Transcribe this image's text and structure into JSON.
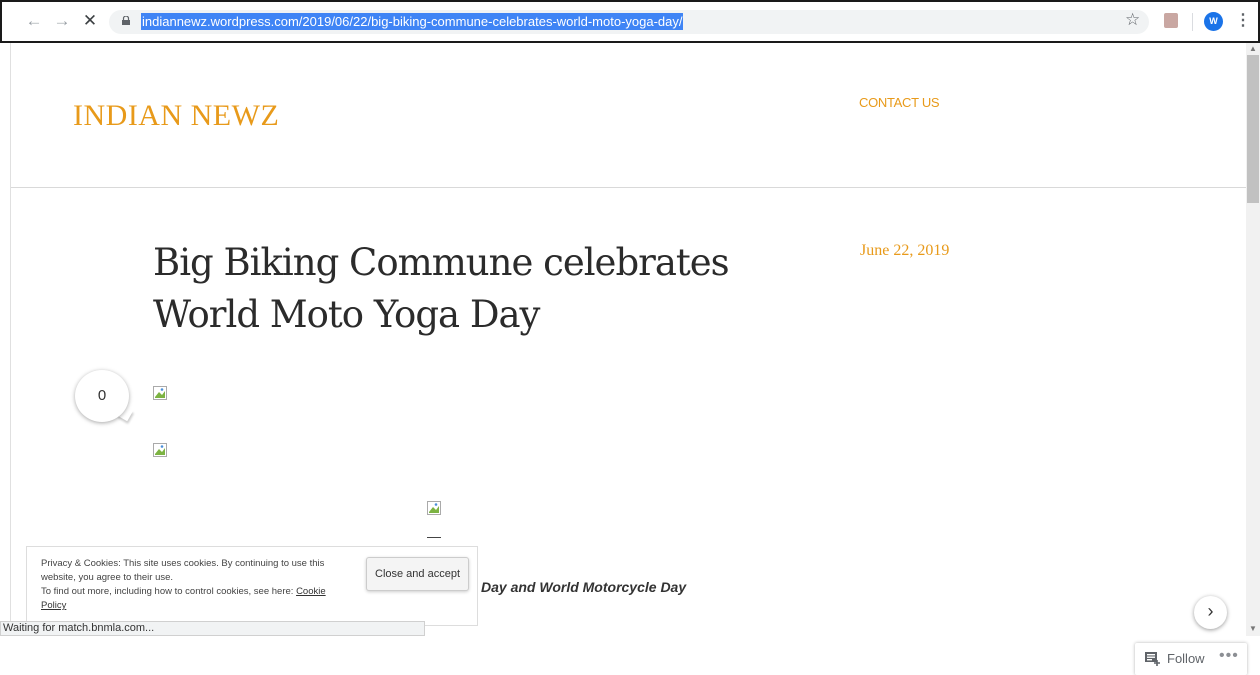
{
  "browser": {
    "url": "indiannewz.wordpress.com/2019/06/22/big-biking-commune-celebrates-world-moto-yoga-day/",
    "back_icon": "arrow-left-icon",
    "forward_icon": "arrow-right-icon",
    "stop_icon": "close-icon",
    "avatar_letter": "W",
    "status_text": "Waiting for match.bnmla.com..."
  },
  "site": {
    "title": "INDIAN NEWZ",
    "nav_contact": "CONTACT US"
  },
  "post": {
    "title": "Big Biking Commune celebrates World Moto Yoga Day",
    "date": "June 22, 2019",
    "comment_count": "0",
    "subline": "Day and World Motorcycle Day"
  },
  "cookie": {
    "text": "Privacy & Cookies: This site uses cookies. By continuing to use this website, you agree to their use.",
    "more_text": "To find out more, including how to control cookies, see here:",
    "link_text": "Cookie Policy",
    "button": "Close and accept"
  },
  "follow": {
    "label": "Follow",
    "more": "•••"
  },
  "colors": {
    "accent": "#e89a1a",
    "url_highlight": "#3f84f5"
  }
}
